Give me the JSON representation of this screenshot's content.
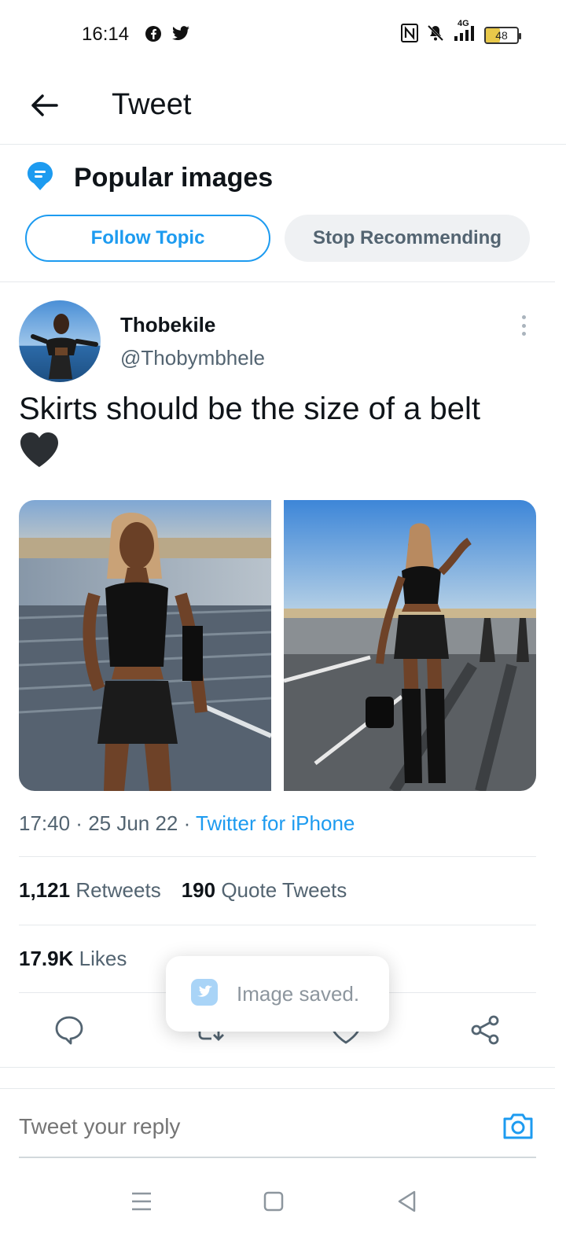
{
  "status_bar": {
    "time": "16:14",
    "battery": "48",
    "network": "4G",
    "icons": [
      "facebook-icon",
      "twitter-icon",
      "nfc-icon",
      "mute-icon",
      "signal-icon",
      "battery-icon"
    ]
  },
  "header": {
    "title": "Tweet"
  },
  "topic": {
    "title": "Popular images",
    "follow_label": "Follow Topic",
    "stop_label": "Stop Recommending"
  },
  "tweet": {
    "author_name": "Thobekile",
    "author_handle": "@Thobymbhele",
    "text": "Skirts should be the size of a belt",
    "time": "17:40",
    "date": "25 Jun 22",
    "source": "Twitter for iPhone",
    "retweets_count": "1,121",
    "retweets_label": "Retweets",
    "quotes_count": "190",
    "quotes_label": "Quote Tweets",
    "likes_count": "17.9K",
    "likes_label": "Likes"
  },
  "toast": {
    "text": "Image saved."
  },
  "reply": {
    "placeholder": "Tweet your reply"
  },
  "colors": {
    "accent": "#1d9bf0",
    "text_primary": "#0f1419",
    "text_secondary": "#536471",
    "divider": "#e6e9ec"
  }
}
